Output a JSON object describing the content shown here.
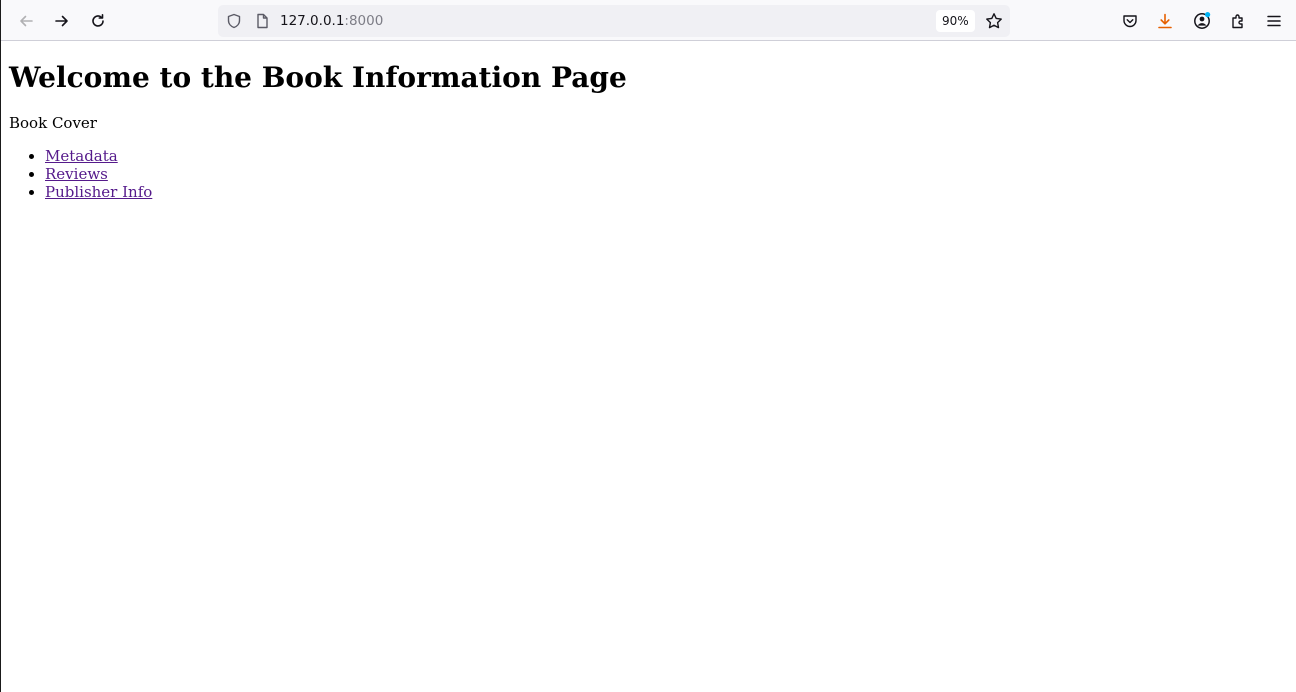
{
  "browser": {
    "url_host": "127.0.0.1",
    "url_port": ":8000",
    "zoom": "90%",
    "icons": {
      "back": "arrow-left-icon",
      "forward": "arrow-right-icon",
      "reload": "reload-icon",
      "shield": "shield-icon",
      "page": "page-icon",
      "bookmark": "star-icon",
      "pocket": "pocket-icon",
      "downloads": "download-icon",
      "account": "account-icon",
      "extensions": "puzzle-icon",
      "menu": "hamburger-menu-icon"
    },
    "colors": {
      "download_accent": "#e66000",
      "notification_dot": "#00b3f4",
      "link_visited": "#551a8b"
    }
  },
  "page": {
    "heading": "Welcome to the Book Information Page",
    "cover_text": "Book Cover",
    "links": [
      {
        "label": "Metadata"
      },
      {
        "label": "Reviews"
      },
      {
        "label": "Publisher Info"
      }
    ]
  }
}
